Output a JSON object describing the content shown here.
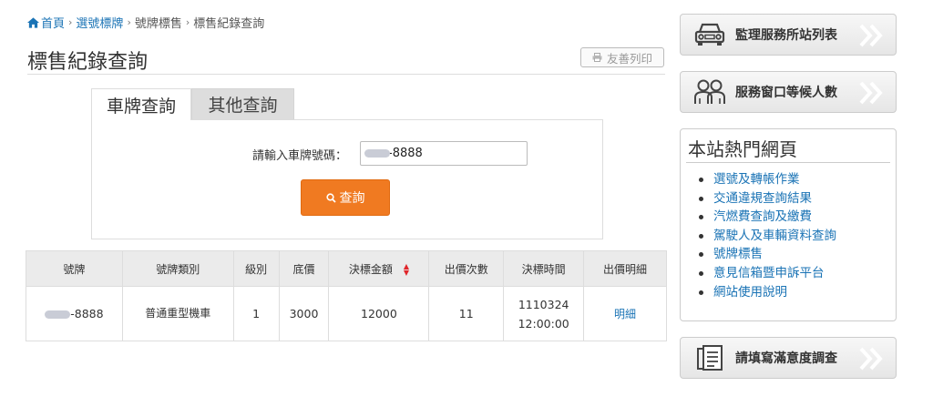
{
  "breadcrumb": {
    "home": "首頁",
    "level1": "選號標牌",
    "level2": "號牌標售",
    "current": "標售紀錄查詢"
  },
  "page": {
    "title": "標售紀錄查詢",
    "print_label": "友善列印"
  },
  "tabs": [
    {
      "label": "車牌查詢",
      "active": true
    },
    {
      "label": "其他查詢",
      "active": false
    }
  ],
  "search": {
    "label": "請輸入車牌號碼：",
    "value": "-8888",
    "button_label": "查詢"
  },
  "table": {
    "headers": [
      "號牌",
      "號牌類別",
      "級別",
      "底價",
      "決標金額",
      "出價次數",
      "決標時間",
      "出價明細"
    ],
    "rows": [
      {
        "plate": "-8888",
        "category": "普通重型機車",
        "level": "1",
        "base_price": "3000",
        "final_price": "12000",
        "bid_count": "11",
        "date": "1110324",
        "time": "12:00:00",
        "detail": "明細"
      }
    ]
  },
  "sidebar": {
    "stations_button": "監理服務所站列表",
    "waiting_button": "服務窗口等候人數",
    "hot_title": "本站熱門網頁",
    "hot_links": [
      "選號及轉帳作業",
      "交通違規查詢結果",
      "汽燃費查詢及繳費",
      "駕駛人及車輛資料查詢",
      "號牌標售",
      "意見信箱暨申訴平台",
      "網站使用說明"
    ],
    "survey_button": "請填寫滿意度調查"
  },
  "colors": {
    "link": "#1a73b5",
    "search_button": "#f07a21",
    "sort_arrow": "#e0262b"
  }
}
